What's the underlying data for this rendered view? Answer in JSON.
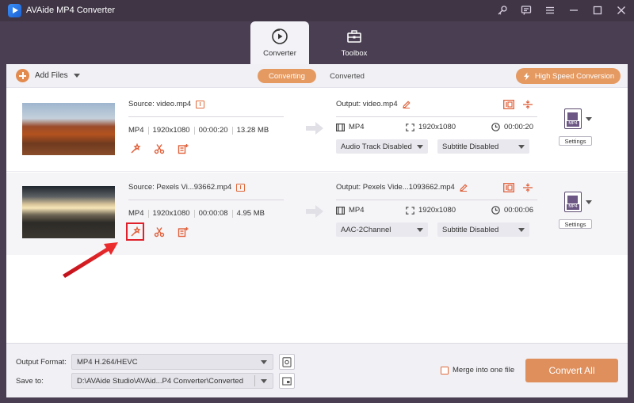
{
  "app": {
    "title": "AVAide MP4 Converter"
  },
  "tabs": [
    {
      "label": "Converter",
      "active": true,
      "icon": "converter-icon"
    },
    {
      "label": "Toolbox",
      "active": false,
      "icon": "toolbox-icon"
    }
  ],
  "toolbar": {
    "add_files_label": "Add Files",
    "segments": [
      "Converting",
      "Converted"
    ],
    "high_speed_label": "High Speed Conversion"
  },
  "files": [
    {
      "source_label": "Source: video.mp4",
      "format": "MP4",
      "resolution": "1920x1080",
      "duration": "00:00:20",
      "size": "13.28 MB",
      "output_label": "Output: video.mp4",
      "out_format": "MP4",
      "out_resolution": "1920x1080",
      "out_duration": "00:00:20",
      "audio_track": "Audio Track Disabled",
      "subtitle": "Subtitle Disabled",
      "format_badge": "MP4",
      "settings_label": "Settings"
    },
    {
      "source_label": "Source: Pexels Vi...93662.mp4",
      "format": "MP4",
      "resolution": "1920x1080",
      "duration": "00:00:08",
      "size": "4.95 MB",
      "output_label": "Output: Pexels Vide...1093662.mp4",
      "out_format": "MP4",
      "out_resolution": "1920x1080",
      "out_duration": "00:00:06",
      "audio_track": "AAC-2Channel",
      "subtitle": "Subtitle Disabled",
      "format_badge": "MP4",
      "settings_label": "Settings"
    }
  ],
  "footer": {
    "output_format_label": "Output Format:",
    "output_format_value": "MP4 H.264/HEVC",
    "save_to_label": "Save to:",
    "save_to_value": "D:\\AVAide Studio\\AVAid...P4 Converter\\Converted",
    "merge_label": "Merge into one file",
    "merge_checked": false,
    "convert_all_label": "Convert All"
  },
  "colors": {
    "accent": "#e59a62",
    "titlebar": "#3f3545",
    "highlight": "#e0202a"
  }
}
